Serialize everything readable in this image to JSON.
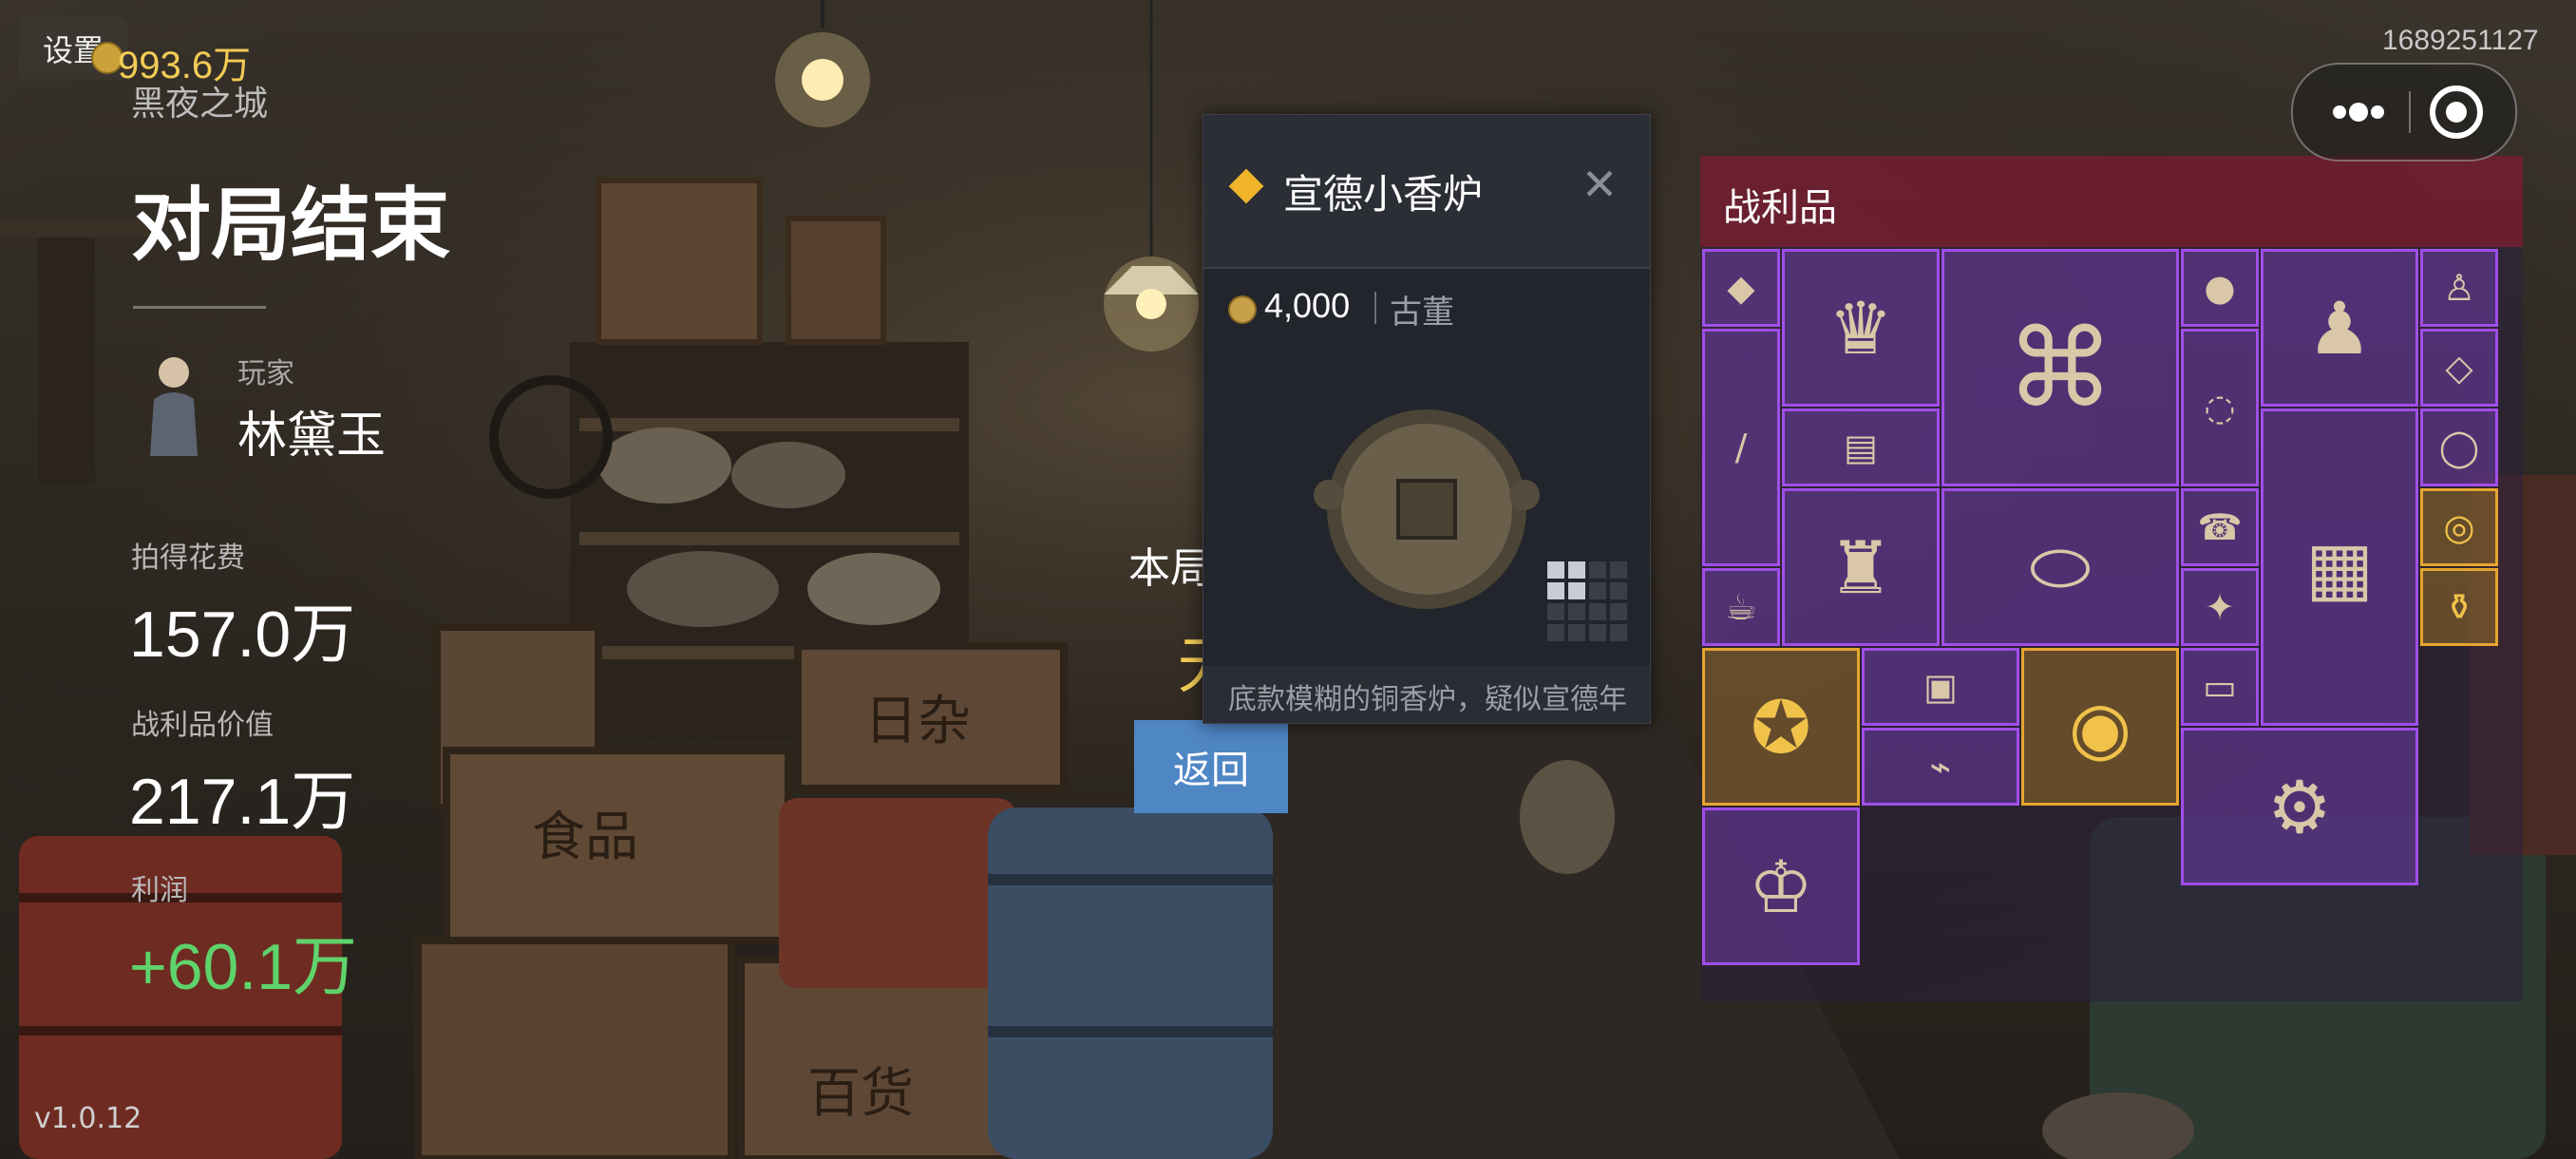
{
  "top_bar": {
    "settings_label": "设置",
    "money": "993.6万",
    "city": "黑夜之城",
    "user_id": "1689251127"
  },
  "summary": {
    "title": "对局结束",
    "player_label": "玩家",
    "player_name": "林黛玉",
    "spend_label": "拍得花费",
    "spend_value": "157.0万",
    "loot_value_label": "战利品价值",
    "loot_value": "217.1万",
    "profit_label": "利润",
    "profit_value": "+60.1万",
    "version": "v1.0.12"
  },
  "bonus": {
    "label": "本局福利",
    "value": "无",
    "back_button": "返回"
  },
  "item_card": {
    "name": "宣德小香炉",
    "price": "4,000",
    "category": "古董",
    "description": "底款模糊的铜香炉，疑似宣德年",
    "close_icon": "close-icon"
  },
  "loot": {
    "title": "战利品",
    "items": [
      {
        "name": "purple-gem-box",
        "rarity": "purple"
      },
      {
        "name": "tiffany-lamp",
        "rarity": "purple"
      },
      {
        "name": "film-projector",
        "rarity": "purple"
      },
      {
        "name": "red-pendant",
        "rarity": "purple"
      },
      {
        "name": "buddha-statue",
        "rarity": "purple"
      },
      {
        "name": "small-gold-buddha",
        "rarity": "purple"
      },
      {
        "name": "telescope",
        "rarity": "purple"
      },
      {
        "name": "radio",
        "rarity": "purple"
      },
      {
        "name": "bead-necklace",
        "rarity": "purple"
      },
      {
        "name": "quartz-stone",
        "rarity": "purple"
      },
      {
        "name": "brass-lantern",
        "rarity": "purple"
      },
      {
        "name": "hoverboard",
        "rarity": "purple"
      },
      {
        "name": "retro-phone",
        "rarity": "purple"
      },
      {
        "name": "control-panel",
        "rarity": "purple"
      },
      {
        "name": "jade-bracelet",
        "rarity": "purple"
      },
      {
        "name": "teapot",
        "rarity": "purple"
      },
      {
        "name": "light-bulb",
        "rarity": "purple"
      },
      {
        "name": "gold-ring",
        "rarity": "gold"
      },
      {
        "name": "gold-vase",
        "rarity": "gold"
      },
      {
        "name": "gold-gear-orb",
        "rarity": "gold"
      },
      {
        "name": "circuit-chip",
        "rarity": "purple"
      },
      {
        "name": "bronze-censer",
        "rarity": "gold"
      },
      {
        "name": "blue-book",
        "rarity": "purple"
      },
      {
        "name": "telegraph-key",
        "rarity": "purple"
      },
      {
        "name": "generator",
        "rarity": "purple"
      },
      {
        "name": "tiara",
        "rarity": "purple"
      }
    ]
  },
  "colors": {
    "gold": "#f3cc56",
    "profit_green": "#5fd36b",
    "purple_border": "#a04ee8",
    "gold_border": "#e6a530",
    "loot_header": "#7a1e2d",
    "back_button": "#4f86c4"
  }
}
